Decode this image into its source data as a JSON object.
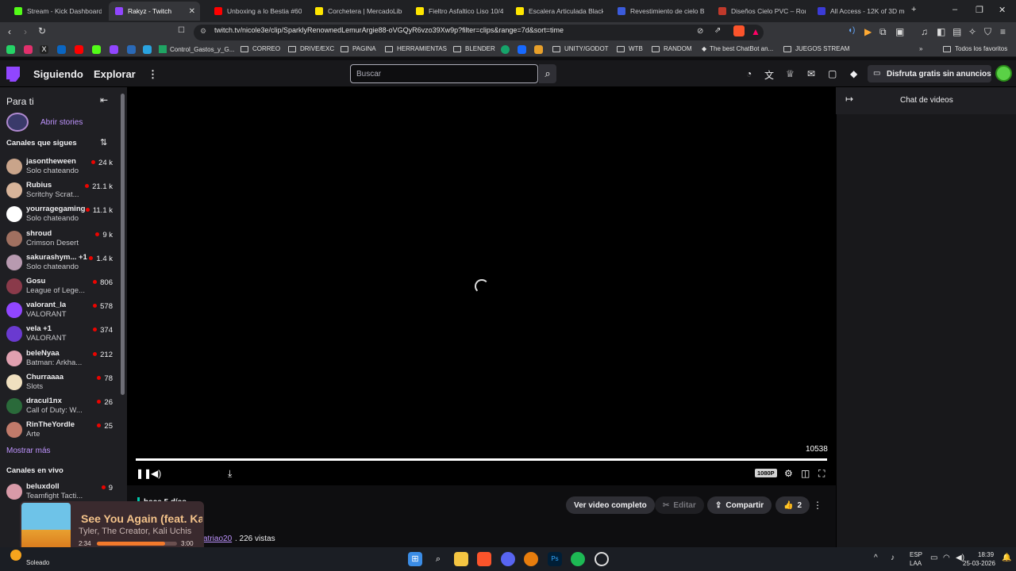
{
  "browser": {
    "tabs": [
      {
        "title": "Stream - Kick Dashboard",
        "color": "#53fc18"
      },
      {
        "title": "Rakyz - Twitch",
        "color": "#9146ff",
        "active": true
      },
      {
        "title": "Unboxing a lo Bestia #60 /",
        "color": "#ff0000"
      },
      {
        "title": "Corchetera | MercadoLibre",
        "color": "#ffe600"
      },
      {
        "title": "Fieltro Asfaltico Liso 10/40",
        "color": "#ffe600"
      },
      {
        "title": "Escalera Articulada Black+",
        "color": "#ffe600"
      },
      {
        "title": "Revestimiento de cielo Bla",
        "color": "#3b5bdb"
      },
      {
        "title": "Diseños Cielo PVC – Roma",
        "color": "#c0392b"
      },
      {
        "title": "All Access - 12K of 3D mo",
        "color": "#3b3bd6"
      }
    ],
    "url": "twitch.tv/nicole3e/clip/SparklyRenownedLemurArgie88-oVGQyR6vzo39Xw9p?filter=clips&range=7d&sort=time",
    "bookmarks": [
      "Control_Gastos_y_G...",
      "CORREO",
      "DRIVE/EXC",
      "PAGINA",
      "HERRAMIENTAS",
      "BLENDER",
      "UNITY/GODOT",
      "WTB",
      "RANDOM",
      "The best ChatBot an...",
      "JUEGOS STREAM"
    ],
    "all_bookmarks": "Todos los favoritos"
  },
  "nav": {
    "following": "Siguiendo",
    "explore": "Explorar",
    "search_placeholder": "Buscar",
    "ad_free": "Disfruta gratis sin anuncios"
  },
  "sidebar": {
    "for_you": "Para ti",
    "open_stories": "Abrir stories",
    "followed_header": "Canales que sigues",
    "channels": [
      {
        "name": "jasontheween",
        "game": "Solo chateando",
        "viewers": "24 k",
        "color": "#c9a48a"
      },
      {
        "name": "Rubius",
        "game": "Scritchy Scrat...",
        "viewers": "21.1 k",
        "color": "#d8b49a"
      },
      {
        "name": "yourragegaming",
        "game": "Solo chateando",
        "viewers": "11.1 k",
        "color": "#ffffff"
      },
      {
        "name": "shroud",
        "game": "Crimson Desert",
        "viewers": "9 k",
        "color": "#a07060"
      },
      {
        "name": "sakurashym... +1",
        "game": "Solo chateando",
        "viewers": "1.4 k",
        "color": "#b89ab0"
      },
      {
        "name": "Gosu",
        "game": "League of Lege...",
        "viewers": "806",
        "color": "#8a3a4a"
      },
      {
        "name": "valorant_la",
        "game": "VALORANT",
        "viewers": "578",
        "color": "#9146ff"
      },
      {
        "name": "vela +1",
        "game": "VALORANT",
        "viewers": "374",
        "color": "#6a3ad0"
      },
      {
        "name": "beleNyaa",
        "game": "Batman: Arkha...",
        "viewers": "212",
        "color": "#e0a0b0"
      },
      {
        "name": "Churraaaa",
        "game": "Slots",
        "viewers": "78",
        "color": "#f0e0c0"
      },
      {
        "name": "dracul1nx",
        "game": "Call of Duty: W...",
        "viewers": "26",
        "color": "#2a6a3a"
      },
      {
        "name": "RinTheYordle",
        "game": "Arte",
        "viewers": "25",
        "color": "#c07a6a"
      }
    ],
    "show_more": "Mostrar más",
    "live_header": "Canales en vivo",
    "live_channels": [
      {
        "name": "beluxdoll",
        "game": "Teamfight Tacti...",
        "viewers": "9",
        "color": "#d89aa8"
      }
    ]
  },
  "player": {
    "view_count": "10538",
    "quality": "1080P",
    "progress": 1.0
  },
  "chat": {
    "title": "Chat de videos"
  },
  "clip": {
    "age": "hace 5 días",
    "watch_full": "Ver video completo",
    "edit": "Editar",
    "share": "Compartir",
    "likes": "2",
    "clipped_by": "atriao20",
    "views": ". 226 vistas"
  },
  "music": {
    "title": "See You Again (feat. Kali Uchis)",
    "artist": "Tyler, The Creator, Kali Uchis",
    "elapsed": "2:34",
    "duration": "3:00",
    "progress": 0.855
  },
  "taskbar": {
    "weather": "Soleado",
    "lang1": "ESP",
    "lang2": "LAA",
    "time": "18:39",
    "date": "25-03-2026"
  }
}
